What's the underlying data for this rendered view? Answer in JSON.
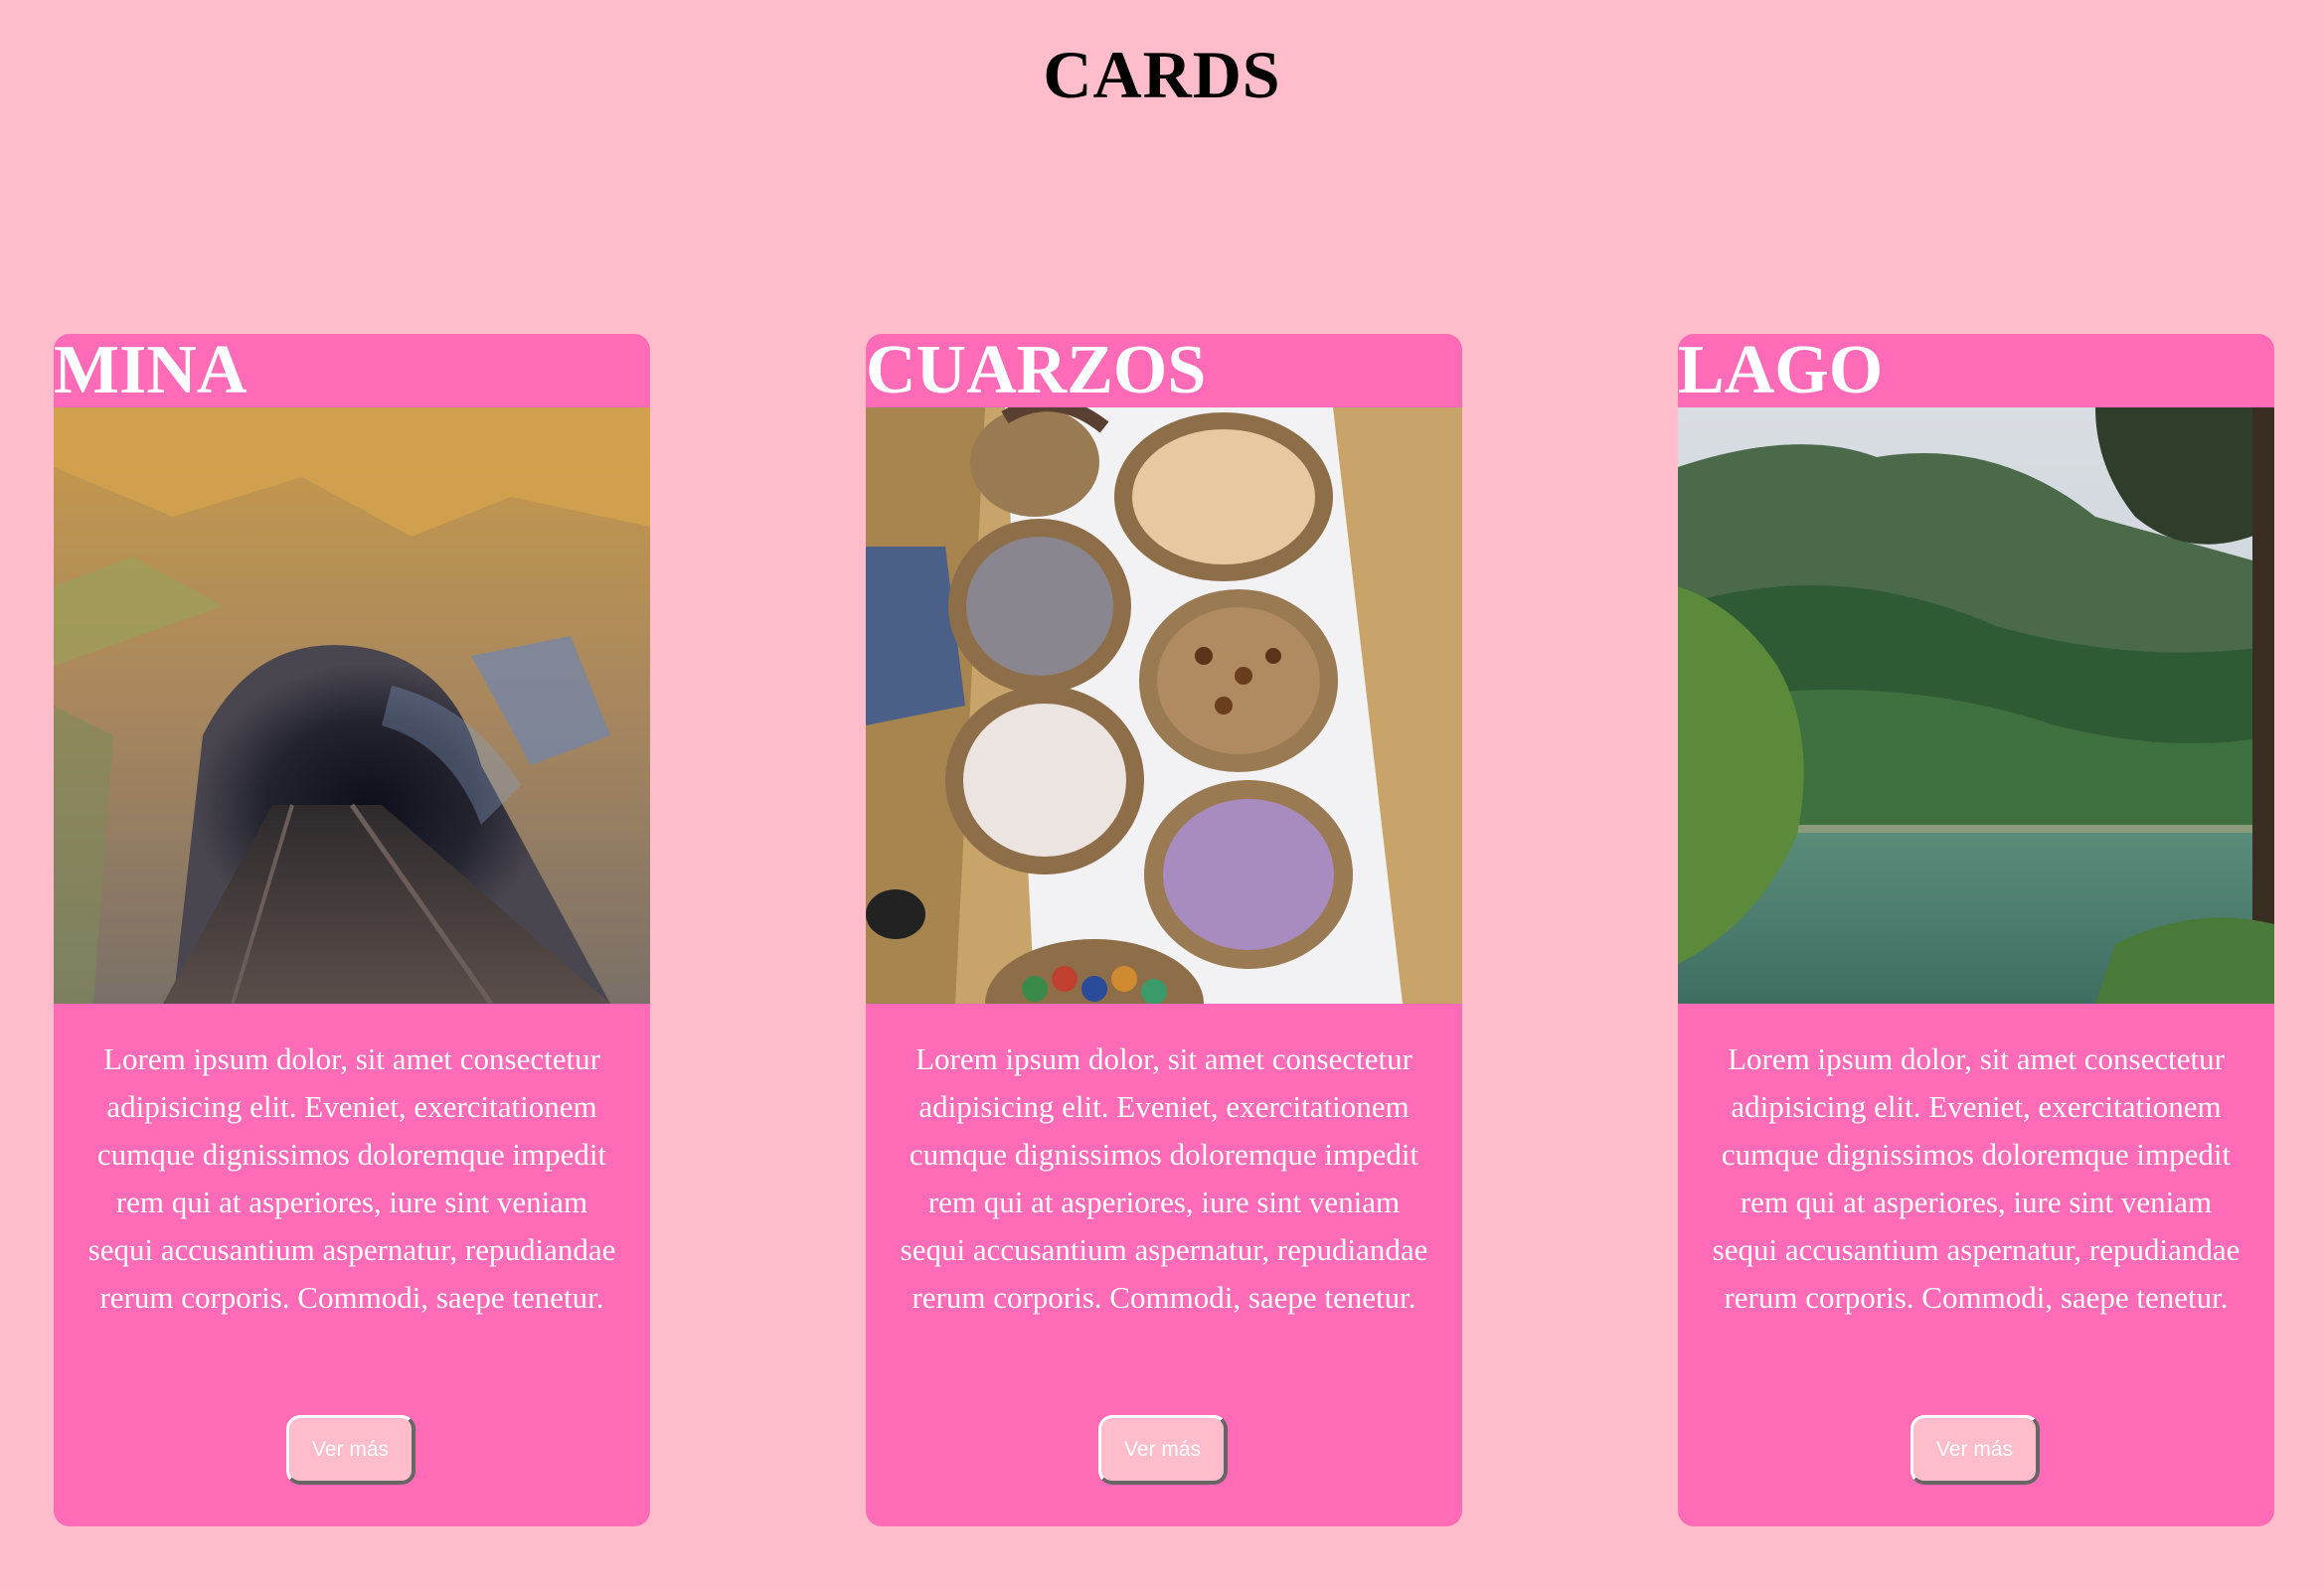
{
  "page": {
    "title": "CARDS",
    "background": "#ffbcca",
    "card_background": "#ff6bb6"
  },
  "cards": [
    {
      "title": "MINA",
      "image": "mine-tunnel-photo",
      "text": "Lorem ipsum dolor, sit amet consectetur adipisicing elit. Eveniet, exercitationem cumque dignissimos doloremque impedit rem qui at asperiores, iure sint veniam sequi accusantium aspernatur, repudiandae rerum corporis. Commodi, saepe tenetur.",
      "button_label": "Ver más"
    },
    {
      "title": "CUARZOS",
      "image": "quartz-baskets-photo",
      "text": "Lorem ipsum dolor, sit amet consectetur adipisicing elit. Eveniet, exercitationem cumque dignissimos doloremque impedit rem qui at asperiores, iure sint veniam sequi accusantium aspernatur, repudiandae rerum corporis. Commodi, saepe tenetur.",
      "button_label": "Ver más"
    },
    {
      "title": "LAGO",
      "image": "forest-lake-photo",
      "text": "Lorem ipsum dolor, sit amet consectetur adipisicing elit. Eveniet, exercitationem cumque dignissimos doloremque impedit rem qui at asperiores, iure sint veniam sequi accusantium aspernatur, repudiandae rerum corporis. Commodi, saepe tenetur.",
      "button_label": "Ver más"
    }
  ]
}
